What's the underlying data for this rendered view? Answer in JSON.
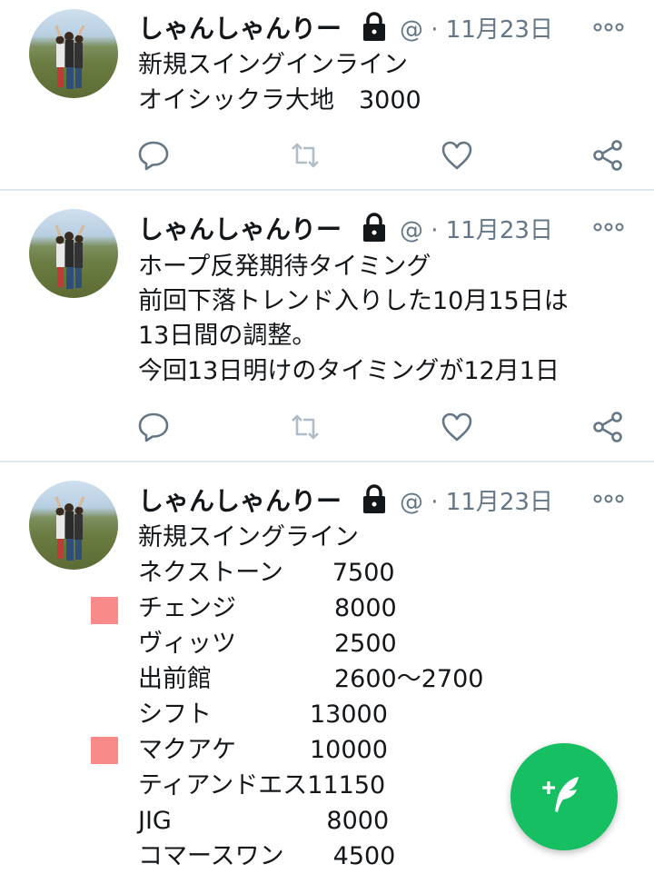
{
  "tweets": [
    {
      "author": "しゃんしゃんりー",
      "meta": "@ · 11月23日",
      "lines": [
        "新規スイングインライン",
        "オイシックラ大地　3000"
      ]
    },
    {
      "author": "しゃんしゃんりー",
      "meta": "@ · 11月23日",
      "lines": [
        "ホープ反発期待タイミング",
        "前回下落トレンド入りした10月15日は",
        "13日間の調整。",
        "今回13日明けのタイミングが12月1日"
      ]
    },
    {
      "author": "しゃんしゃんりー",
      "meta": "@ · 11月23日",
      "lines": [
        "新規スイングライン",
        "ネクストーン　　7500",
        "チェンジ　　　　8000",
        "ヴィッツ　　　　2500",
        "出前館　　　　　2600〜2700",
        "シフト　　　　13000",
        "マクアケ　　　10000",
        "ティアンドエス11150",
        "JIG　　　　　　 8000",
        "コマースワン　　4500"
      ]
    }
  ],
  "icons": {
    "reply": "reply-icon",
    "retweet": "retweet-icon",
    "like": "heart-icon",
    "share": "share-icon",
    "lock": "lock-icon",
    "more": "more-icon",
    "compose": "compose-tweet-icon"
  },
  "colors": {
    "accent": "#17bf63",
    "muted": "#657786",
    "marker": "#f88a8a",
    "divider": "#e1e8ed"
  }
}
